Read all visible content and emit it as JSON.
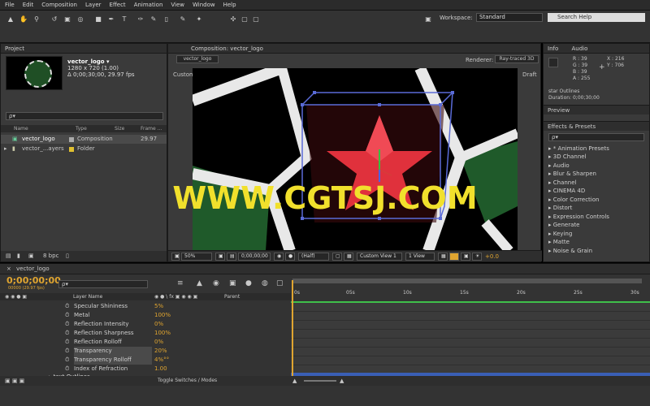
{
  "menu": [
    "File",
    "Edit",
    "Composition",
    "Layer",
    "Effect",
    "Animation",
    "View",
    "Window",
    "Help"
  ],
  "workspace": {
    "label": "Workspace:",
    "value": "Standard",
    "search_placeholder": "Search Help"
  },
  "project": {
    "tab": "Project",
    "comp_name": "vector_logo ▾",
    "comp_size": "1280 x 720 (1.00)",
    "comp_duration": "Δ 0;00;30;00, 29.97 fps",
    "search_placeholder": "ρ▾",
    "columns": [
      "Name",
      "Type",
      "Size",
      "Frame ..."
    ],
    "items": [
      {
        "name": "vector_logo",
        "type": "Composition",
        "fps": "29.97"
      },
      {
        "name": "vector_...ayers",
        "type": "Folder",
        "fps": ""
      }
    ],
    "bpc": "8 bpc"
  },
  "composition": {
    "tab": "Composition: vector_logo",
    "subtab": "vector_logo",
    "renderer_label": "Renderer:",
    "renderer": "Ray-traced 3D",
    "view_label": "Custom View 1",
    "draft": "Draft",
    "zoom": "50%",
    "timecode": "0;00;00;00",
    "resolution": "(Half)",
    "view": "Custom View 1",
    "views": "1 View",
    "exposure": "+0.0"
  },
  "info": {
    "tab": "Info",
    "tab2": "Audio",
    "r": "R : 39",
    "g": "G : 39",
    "b": "B : 39",
    "a": "A : 255",
    "x": "X : 216",
    "y": "Y : 706",
    "status1": "star Outlines",
    "status2": "Duration: 0;00;30;00"
  },
  "preview": {
    "tab": "Preview"
  },
  "effects": {
    "tab": "Effects & Presets",
    "search_placeholder": "ρ▾",
    "items": [
      "* Animation Presets",
      "3D Channel",
      "Audio",
      "Blur & Sharpen",
      "Channel",
      "CINEMA 4D",
      "Color Correction",
      "Distort",
      "Expression Controls",
      "Generate",
      "Keying",
      "Matte",
      "Noise & Grain"
    ]
  },
  "timeline": {
    "tab": "vector_logo",
    "timecode": "0;00;00;00",
    "frames": "00000 (29.97 fps)",
    "search_placeholder": "ρ▾",
    "col_layer": "Layer Name",
    "col_parent": "Parent",
    "ticks": [
      "0s",
      "05s",
      "10s",
      "15s",
      "20s",
      "25s",
      "30s"
    ],
    "properties": [
      {
        "name": "Specular Shininess",
        "value": "5%"
      },
      {
        "name": "Metal",
        "value": "100%"
      },
      {
        "name": "Reflection Intensity",
        "value": "0%"
      },
      {
        "name": "Reflection Sharpness",
        "value": "100%"
      },
      {
        "name": "Reflection Rolloff",
        "value": "0%"
      },
      {
        "name": "Transparency",
        "value": "20%"
      },
      {
        "name": "Transparency Rolloff",
        "value": "4%°°"
      },
      {
        "name": "Index of Refraction",
        "value": "1.00"
      }
    ],
    "next_layer": "▸ text Outlines",
    "toggle": "Toggle Switches / Modes"
  },
  "watermark": "WWW.CGTSJ.COM",
  "colors": {
    "accent": "#e0a530",
    "watermark": "#f1e02c",
    "star": "#e0313c",
    "green": "#1f5a2a"
  }
}
